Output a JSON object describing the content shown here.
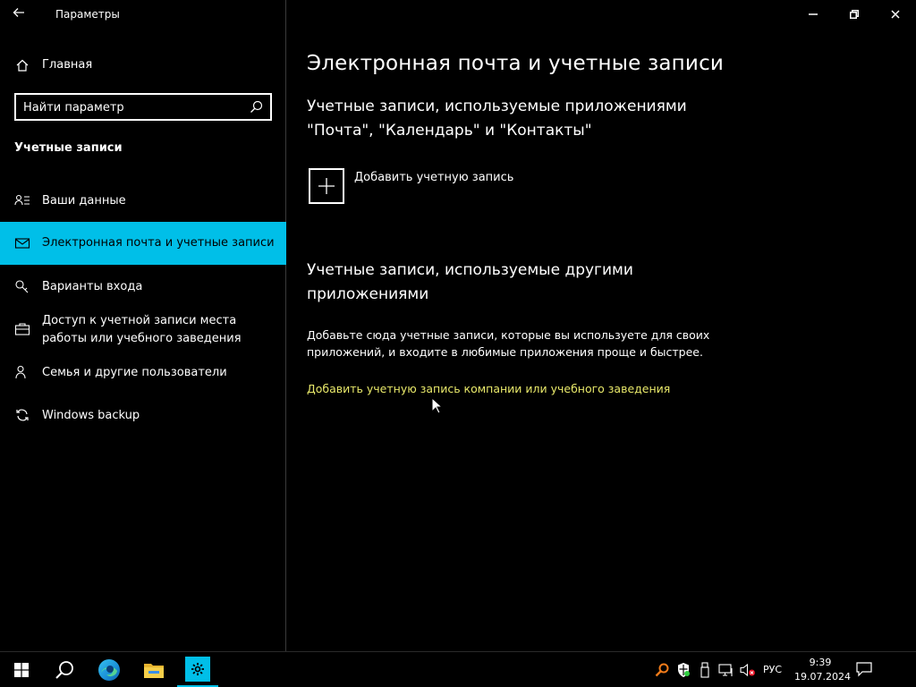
{
  "window": {
    "title": "Параметры",
    "controls": [
      "minimize",
      "restore",
      "close"
    ]
  },
  "sidebar": {
    "home_label": "Главная",
    "search_placeholder": "Найти параметр",
    "section_title": "Учетные записи",
    "items": [
      {
        "label": "Ваши данные",
        "icon": "person-card-icon",
        "active": false
      },
      {
        "label": "Электронная почта и учетные записи",
        "icon": "mail-icon",
        "active": true
      },
      {
        "label": "Варианты входа",
        "icon": "key-icon",
        "active": false
      },
      {
        "label": "Доступ к учетной записи места работы или учебного заведения",
        "icon": "briefcase-icon",
        "active": false
      },
      {
        "label": "Семья и другие пользователи",
        "icon": "person-add-icon",
        "active": false
      },
      {
        "label": "Windows backup",
        "icon": "sync-icon",
        "active": false
      }
    ],
    "accent_color": "#00bfe8"
  },
  "main": {
    "title": "Электронная почта и учетные записи",
    "section1_title": "Учетные записи, используемые приложениями \"Почта\", \"Календарь\" и \"Контакты\"",
    "add_account_label": "Добавить учетную запись",
    "section2_title": "Учетные записи, используемые другими приложениями",
    "section2_desc": "Добавьте сюда учетные записи, которые вы используете для своих приложений, и входите в любимые приложения проще и быстрее.",
    "add_work_link": "Добавить учетную запись компании или учебного заведения",
    "link_color": "#e8e86a"
  },
  "taskbar": {
    "apps": [
      "start-icon",
      "search-icon",
      "edge-icon",
      "file-explorer-icon",
      "settings-icon"
    ],
    "tray_icons": [
      "search-tray-icon",
      "defender-icon",
      "usb-icon",
      "network-icon",
      "volume-muted-icon"
    ],
    "language": "РУС",
    "time": "9:39",
    "date": "19.07.2024"
  }
}
